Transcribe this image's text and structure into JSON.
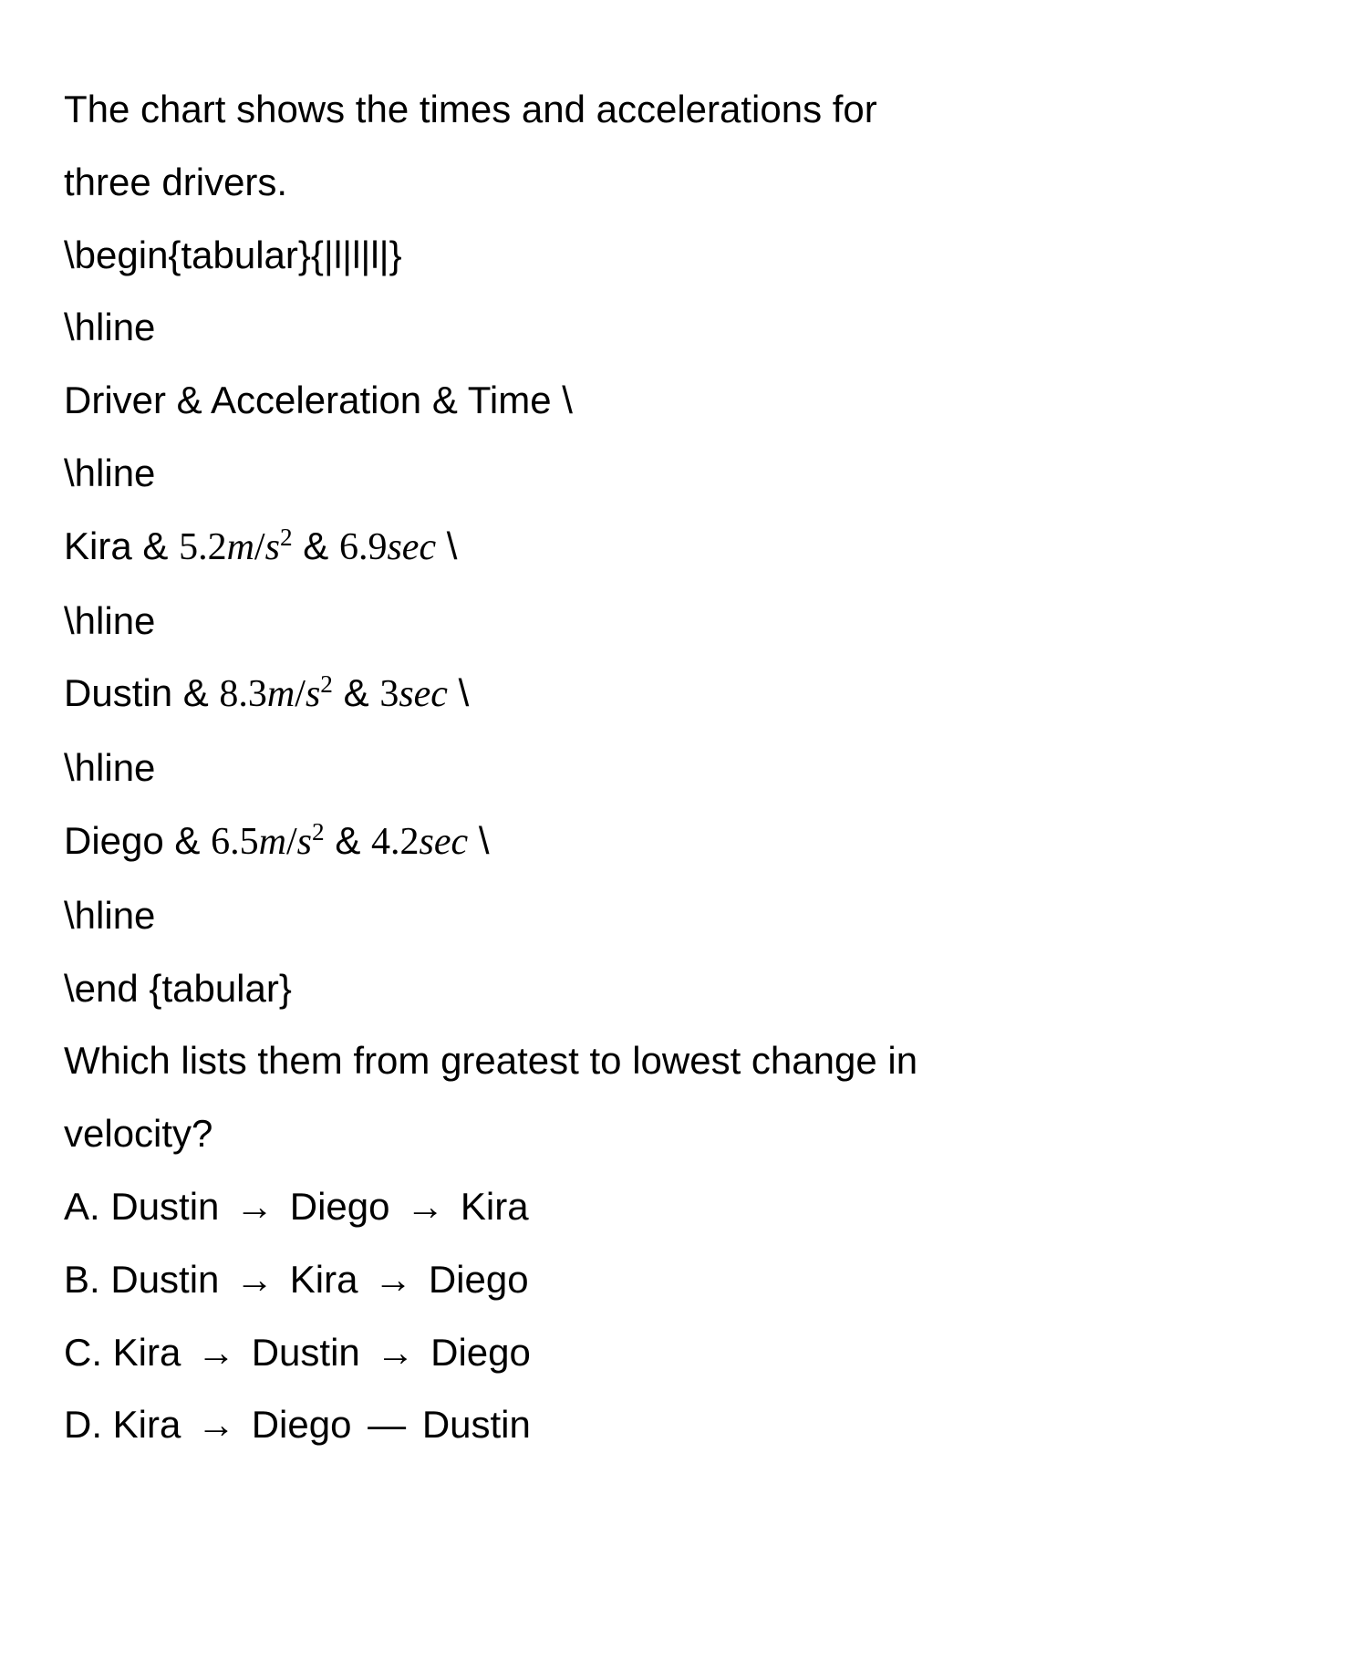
{
  "intro_line1": "The chart shows the times and accelerations for",
  "intro_line2": "three drivers.",
  "latex": {
    "begin_tabular": "\\begin{tabular}{|l|l|l|}",
    "hline": "\\hline",
    "end_tabular": "\\end {tabular}",
    "backslash": "\\"
  },
  "table": {
    "header": {
      "c1": "Driver",
      "c2": "Acceleration",
      "c3": "Time"
    },
    "rows": [
      {
        "driver": "Kira",
        "accel_num": "5.2",
        "accel_unit_m": "m",
        "accel_unit_s": "s",
        "time_num": "6.9",
        "time_unit": "sec"
      },
      {
        "driver": "Dustin",
        "accel_num": "8.3",
        "accel_unit_m": "m",
        "accel_unit_s": "s",
        "time_num": "3",
        "time_unit": "sec"
      },
      {
        "driver": "Diego",
        "accel_num": "6.5",
        "accel_unit_m": "m",
        "accel_unit_s": "s",
        "time_num": "4.2",
        "time_unit": "sec"
      }
    ]
  },
  "question_line1": "Which lists them from greatest to lowest change in",
  "question_line2": "velocity?",
  "amp": "&",
  "choices": [
    {
      "label": "A.",
      "n1": "Dustin",
      "sep1": "→",
      "n2": "Diego",
      "sep2": "→",
      "n3": "Kira"
    },
    {
      "label": "B.",
      "n1": "Dustin",
      "sep1": "→",
      "n2": "Kira",
      "sep2": "→",
      "n3": "Diego"
    },
    {
      "label": "C.",
      "n1": "Kira",
      "sep1": "→",
      "n2": "Dustin",
      "sep2": "→",
      "n3": "Diego"
    },
    {
      "label": "D.",
      "n1": "Kira",
      "sep1": "→",
      "n2": "Diego",
      "sep2": "—",
      "n3": "Dustin"
    }
  ],
  "chart_data": {
    "type": "table",
    "columns": [
      "Driver",
      "Acceleration (m/s^2)",
      "Time (sec)"
    ],
    "rows": [
      [
        "Kira",
        5.2,
        6.9
      ],
      [
        "Dustin",
        8.3,
        3
      ],
      [
        "Diego",
        6.5,
        4.2
      ]
    ]
  }
}
